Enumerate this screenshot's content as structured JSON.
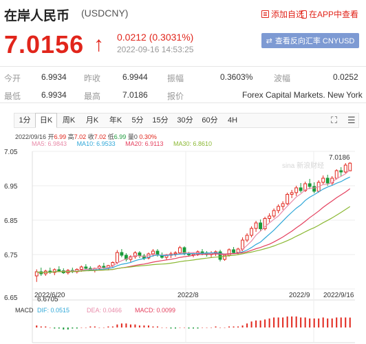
{
  "header": {
    "title": "在岸人民币",
    "code": "(USDCNY)",
    "add_favorite": "添加自选",
    "app_link": "在APP中查看"
  },
  "quote": {
    "price": "7.0156",
    "direction_icon": "↑",
    "change": "0.0212 (0.3031%)",
    "timestamp": "2022-09-16 14:53:25",
    "reverse_button": "查看反向汇率 CNYUSD"
  },
  "stats": {
    "open_label": "今开",
    "open": "6.9934",
    "prev_close_label": "昨收",
    "prev_close": "6.9944",
    "amplitude_label": "振幅",
    "amplitude": "0.3603%",
    "volatility_label": "波幅",
    "volatility": "0.0252",
    "low_label": "最低",
    "low": "6.9934",
    "high_label": "最高",
    "high": "7.0186",
    "source_label": "报价",
    "source": "Forex Capital Markets. New York"
  },
  "tabs": [
    "1分",
    "日K",
    "周K",
    "月K",
    "年K",
    "5分",
    "15分",
    "30分",
    "60分",
    "4H"
  ],
  "active_tab": "日K",
  "ohlc": {
    "date": "2022/09/16",
    "open_label": "开",
    "open": "6.99",
    "high_label": "高",
    "high": "7.02",
    "close_label": "收",
    "close": "7.02",
    "low_label": "低",
    "low": "6.99",
    "vol_label": "量",
    "vol": "0",
    "pct": "0.30%"
  },
  "ma": {
    "ma5": "MA5: 6.9843",
    "ma10": "MA10: 6.9533",
    "ma20": "MA20: 6.9113",
    "ma30": "MA30: 6.8610"
  },
  "macd": {
    "label": "MACD",
    "dif": "DIF: 0.0515",
    "dea": "DEA: 0.0466",
    "macd": "MACD: 0.0099"
  },
  "watermark": "sina 新浪财经",
  "colors": {
    "up": "#e1251b",
    "down": "#1a9a3a",
    "ma5": "#e88aa8",
    "ma10": "#2ea7d8",
    "ma20": "#e43f5d",
    "ma30": "#8bb833",
    "button": "#7d9ad3"
  },
  "chart_data": {
    "type": "candlestick",
    "ylim": [
      6.65,
      7.05
    ],
    "y_ticks": [
      "7.05",
      "6.95",
      "6.85",
      "6.75",
      "6.65"
    ],
    "x_ticks": [
      "2022/6/20",
      "2022/8",
      "2022/9",
      "2022/9/16"
    ],
    "max_label": "7.0186",
    "min_label": "6.6705",
    "candles": [
      {
        "o": 6.688,
        "h": 6.707,
        "l": 6.6705,
        "c": 6.7
      },
      {
        "o": 6.7,
        "h": 6.712,
        "l": 6.688,
        "c": 6.694
      },
      {
        "o": 6.694,
        "h": 6.706,
        "l": 6.688,
        "c": 6.702
      },
      {
        "o": 6.702,
        "h": 6.712,
        "l": 6.694,
        "c": 6.698
      },
      {
        "o": 6.698,
        "h": 6.71,
        "l": 6.69,
        "c": 6.706
      },
      {
        "o": 6.706,
        "h": 6.716,
        "l": 6.7,
        "c": 6.703
      },
      {
        "o": 6.703,
        "h": 6.71,
        "l": 6.694,
        "c": 6.697
      },
      {
        "o": 6.697,
        "h": 6.708,
        "l": 6.692,
        "c": 6.704
      },
      {
        "o": 6.704,
        "h": 6.712,
        "l": 6.696,
        "c": 6.7
      },
      {
        "o": 6.7,
        "h": 6.71,
        "l": 6.695,
        "c": 6.707
      },
      {
        "o": 6.707,
        "h": 6.718,
        "l": 6.7,
        "c": 6.714
      },
      {
        "o": 6.714,
        "h": 6.722,
        "l": 6.706,
        "c": 6.71
      },
      {
        "o": 6.71,
        "h": 6.716,
        "l": 6.702,
        "c": 6.706
      },
      {
        "o": 6.706,
        "h": 6.712,
        "l": 6.698,
        "c": 6.71
      },
      {
        "o": 6.71,
        "h": 6.72,
        "l": 6.704,
        "c": 6.716
      },
      {
        "o": 6.716,
        "h": 6.726,
        "l": 6.708,
        "c": 6.712
      },
      {
        "o": 6.712,
        "h": 6.72,
        "l": 6.704,
        "c": 6.718
      },
      {
        "o": 6.718,
        "h": 6.73,
        "l": 6.712,
        "c": 6.727
      },
      {
        "o": 6.727,
        "h": 6.763,
        "l": 6.722,
        "c": 6.756
      },
      {
        "o": 6.756,
        "h": 6.766,
        "l": 6.742,
        "c": 6.748
      },
      {
        "o": 6.748,
        "h": 6.754,
        "l": 6.73,
        "c": 6.736
      },
      {
        "o": 6.736,
        "h": 6.748,
        "l": 6.726,
        "c": 6.744
      },
      {
        "o": 6.744,
        "h": 6.76,
        "l": 6.738,
        "c": 6.755
      },
      {
        "o": 6.755,
        "h": 6.76,
        "l": 6.74,
        "c": 6.746
      },
      {
        "o": 6.746,
        "h": 6.752,
        "l": 6.734,
        "c": 6.74
      },
      {
        "o": 6.74,
        "h": 6.756,
        "l": 6.736,
        "c": 6.752
      },
      {
        "o": 6.752,
        "h": 6.766,
        "l": 6.744,
        "c": 6.76
      },
      {
        "o": 6.76,
        "h": 6.766,
        "l": 6.744,
        "c": 6.748
      },
      {
        "o": 6.748,
        "h": 6.756,
        "l": 6.738,
        "c": 6.742
      },
      {
        "o": 6.742,
        "h": 6.752,
        "l": 6.734,
        "c": 6.748
      },
      {
        "o": 6.748,
        "h": 6.758,
        "l": 6.74,
        "c": 6.752
      },
      {
        "o": 6.752,
        "h": 6.76,
        "l": 6.744,
        "c": 6.755
      },
      {
        "o": 6.755,
        "h": 6.775,
        "l": 6.75,
        "c": 6.77
      },
      {
        "o": 6.77,
        "h": 6.774,
        "l": 6.748,
        "c": 6.752
      },
      {
        "o": 6.752,
        "h": 6.758,
        "l": 6.744,
        "c": 6.749
      },
      {
        "o": 6.749,
        "h": 6.756,
        "l": 6.742,
        "c": 6.752
      },
      {
        "o": 6.752,
        "h": 6.762,
        "l": 6.746,
        "c": 6.758
      },
      {
        "o": 6.758,
        "h": 6.766,
        "l": 6.748,
        "c": 6.755
      },
      {
        "o": 6.755,
        "h": 6.76,
        "l": 6.744,
        "c": 6.75
      },
      {
        "o": 6.75,
        "h": 6.76,
        "l": 6.742,
        "c": 6.754
      },
      {
        "o": 6.754,
        "h": 6.762,
        "l": 6.746,
        "c": 6.758
      },
      {
        "o": 6.758,
        "h": 6.764,
        "l": 6.73,
        "c": 6.736
      },
      {
        "o": 6.736,
        "h": 6.752,
        "l": 6.732,
        "c": 6.748
      },
      {
        "o": 6.748,
        "h": 6.768,
        "l": 6.744,
        "c": 6.764
      },
      {
        "o": 6.764,
        "h": 6.772,
        "l": 6.752,
        "c": 6.756
      },
      {
        "o": 6.756,
        "h": 6.77,
        "l": 6.75,
        "c": 6.766
      },
      {
        "o": 6.766,
        "h": 6.8,
        "l": 6.76,
        "c": 6.792
      },
      {
        "o": 6.792,
        "h": 6.812,
        "l": 6.786,
        "c": 6.806
      },
      {
        "o": 6.806,
        "h": 6.832,
        "l": 6.8,
        "c": 6.826
      },
      {
        "o": 6.826,
        "h": 6.848,
        "l": 6.816,
        "c": 6.842
      },
      {
        "o": 6.842,
        "h": 6.852,
        "l": 6.818,
        "c": 6.825
      },
      {
        "o": 6.825,
        "h": 6.86,
        "l": 6.82,
        "c": 6.855
      },
      {
        "o": 6.855,
        "h": 6.87,
        "l": 6.844,
        "c": 6.862
      },
      {
        "o": 6.862,
        "h": 6.884,
        "l": 6.856,
        "c": 6.878
      },
      {
        "o": 6.878,
        "h": 6.896,
        "l": 6.87,
        "c": 6.89
      },
      {
        "o": 6.89,
        "h": 6.905,
        "l": 6.88,
        "c": 6.898
      },
      {
        "o": 6.898,
        "h": 6.93,
        "l": 6.894,
        "c": 6.925
      },
      {
        "o": 6.925,
        "h": 6.938,
        "l": 6.914,
        "c": 6.93
      },
      {
        "o": 6.93,
        "h": 6.95,
        "l": 6.92,
        "c": 6.944
      },
      {
        "o": 6.944,
        "h": 6.958,
        "l": 6.93,
        "c": 6.936
      },
      {
        "o": 6.936,
        "h": 6.962,
        "l": 6.932,
        "c": 6.956
      },
      {
        "o": 6.956,
        "h": 6.97,
        "l": 6.94,
        "c": 6.948
      },
      {
        "o": 6.948,
        "h": 6.96,
        "l": 6.928,
        "c": 6.934
      },
      {
        "o": 6.934,
        "h": 6.966,
        "l": 6.93,
        "c": 6.96
      },
      {
        "o": 6.96,
        "h": 6.98,
        "l": 6.954,
        "c": 6.972
      },
      {
        "o": 6.972,
        "h": 6.982,
        "l": 6.95,
        "c": 6.958
      },
      {
        "o": 6.958,
        "h": 6.978,
        "l": 6.952,
        "c": 6.972
      },
      {
        "o": 6.972,
        "h": 6.998,
        "l": 6.968,
        "c": 6.994
      },
      {
        "o": 6.994,
        "h": 7.004,
        "l": 6.978,
        "c": 6.99
      },
      {
        "o": 6.99,
        "h": 7.016,
        "l": 6.986,
        "c": 7.01
      },
      {
        "o": 6.9934,
        "h": 7.0186,
        "l": 6.9934,
        "c": 7.0156
      }
    ],
    "macd_hist": [
      0.002,
      0.001,
      0.001,
      0.0,
      -0.001,
      -0.001,
      -0.002,
      -0.002,
      -0.001,
      -0.001,
      0.0,
      0.0,
      0.001,
      0.001,
      0.0,
      0.0,
      0.001,
      0.001,
      0.003,
      0.004,
      0.004,
      0.003,
      0.003,
      0.002,
      0.002,
      0.002,
      0.001,
      0.001,
      0.0,
      0.0,
      -0.001,
      -0.001,
      0.0,
      0.0,
      -0.001,
      -0.001,
      -0.001,
      0.0,
      0.0,
      0.0,
      0.001,
      0.0,
      0.0,
      0.001,
      0.001,
      0.001,
      0.002,
      0.004,
      0.006,
      0.007,
      0.007,
      0.008,
      0.009,
      0.01,
      0.01,
      0.01,
      0.011,
      0.011,
      0.011,
      0.01,
      0.01,
      0.009,
      0.009,
      0.009,
      0.01,
      0.009,
      0.009,
      0.01,
      0.01,
      0.01,
      0.0099
    ]
  }
}
